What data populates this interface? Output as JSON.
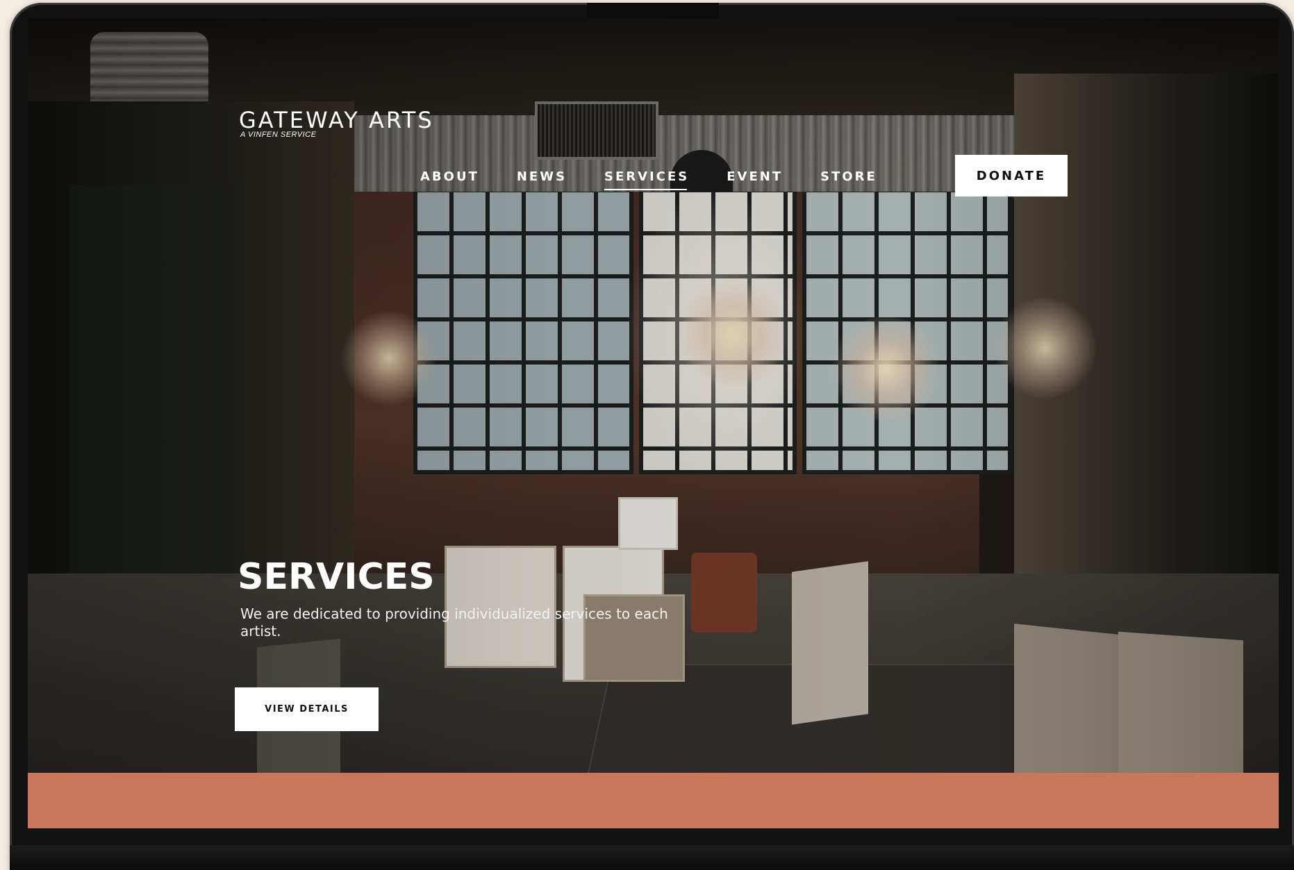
{
  "brand": {
    "title": "GATEWAY ARTS",
    "subtitle": "A VINFEN SERVICE"
  },
  "nav": {
    "items": [
      {
        "label": "ABOUT",
        "active": false
      },
      {
        "label": "NEWS",
        "active": false
      },
      {
        "label": "SERVICES",
        "active": true
      },
      {
        "label": "EVENT",
        "active": false
      },
      {
        "label": "STORE",
        "active": false
      }
    ],
    "donate_label": "DONATE"
  },
  "hero": {
    "title": "SERVICES",
    "description": "We are dedicated to providing individualized services to each artist.",
    "button_label": "VIEW DETAILS"
  },
  "colors": {
    "accent_band": "#c9765a",
    "button_bg": "#ffffff",
    "text_light": "#ffffff",
    "page_background": "#f3ede4",
    "device_frame": "#121212"
  }
}
